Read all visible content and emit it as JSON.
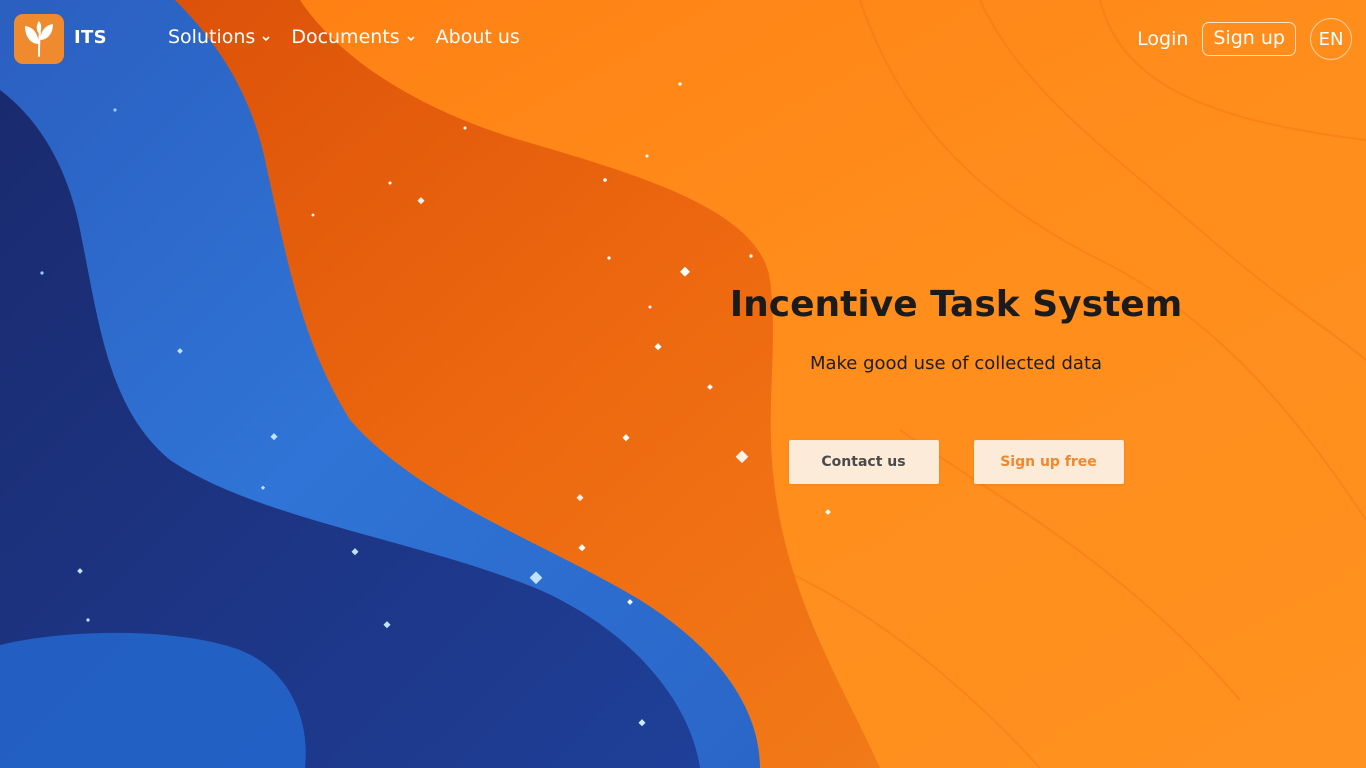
{
  "brand": {
    "name": "ITS",
    "logo_icon": "leaf-sprout-icon",
    "logo_color": "#f08a2e"
  },
  "nav": {
    "menu": [
      {
        "label": "Solutions",
        "has_dropdown": true
      },
      {
        "label": "Documents",
        "has_dropdown": true
      },
      {
        "label": "About us",
        "has_dropdown": false
      }
    ],
    "login_label": "Login",
    "signup_label": "Sign up",
    "language": "EN"
  },
  "hero": {
    "title": "Incentive Task System",
    "subtitle": "Make good use of collected data",
    "contact_label": "Contact us",
    "signup_free_label": "Sign up free"
  },
  "colors": {
    "orange_bg": "#ff8a1a",
    "deep_orange": "#e25a0c",
    "blue": "#2a6fd0",
    "navy": "#1a2f7a",
    "button_bg": "#fdebd9",
    "button_accent_text": "#f0882e"
  }
}
